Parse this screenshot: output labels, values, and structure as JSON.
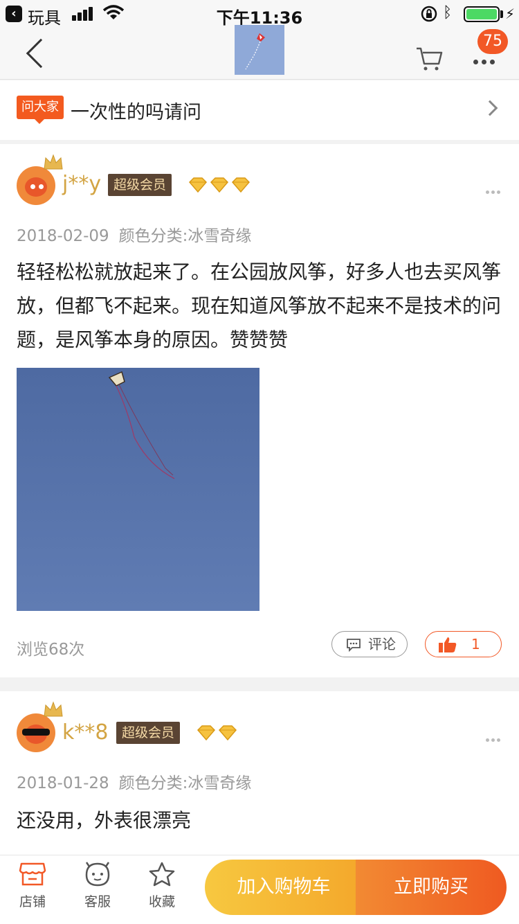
{
  "status_bar": {
    "back_app": "玩具",
    "time": "下午11:36",
    "battery_level": 1.0
  },
  "nav": {
    "badge_count": "75"
  },
  "question": {
    "tag": "问大家",
    "text": "一次性的吗请问"
  },
  "reviews": [
    {
      "username": "j**y",
      "member_label": "超级会员",
      "diamond_count": 3,
      "date": "2018-02-09",
      "variant": "颜色分类:冰雪奇缘",
      "text": "轻轻松松就放起来了。在公园放风筝，好多人也去买风筝放，但都飞不起来。现在知道风筝放不起来不是技术的问题，是风筝本身的原因。赞赞赞",
      "views": "浏览68次",
      "comment_label": "评论",
      "like_count": "1"
    },
    {
      "username": "k**8",
      "member_label": "超级会员",
      "diamond_count": 2,
      "date": "2018-01-28",
      "variant": "颜色分类:冰雪奇缘",
      "text": "还没用，外表很漂亮"
    }
  ],
  "bottom_bar": {
    "tabs": [
      {
        "label": "店铺",
        "icon": "store-icon"
      },
      {
        "label": "客服",
        "icon": "service-icon"
      },
      {
        "label": "收藏",
        "icon": "star-icon"
      }
    ],
    "add_to_cart": "加入购物车",
    "buy_now": "立即购买"
  },
  "colors": {
    "accent": "#f25826",
    "username": "#d3a443",
    "add_cart": "#f5b933",
    "buy_now": "#ef5a21",
    "photo_sky": "#5873a9"
  }
}
